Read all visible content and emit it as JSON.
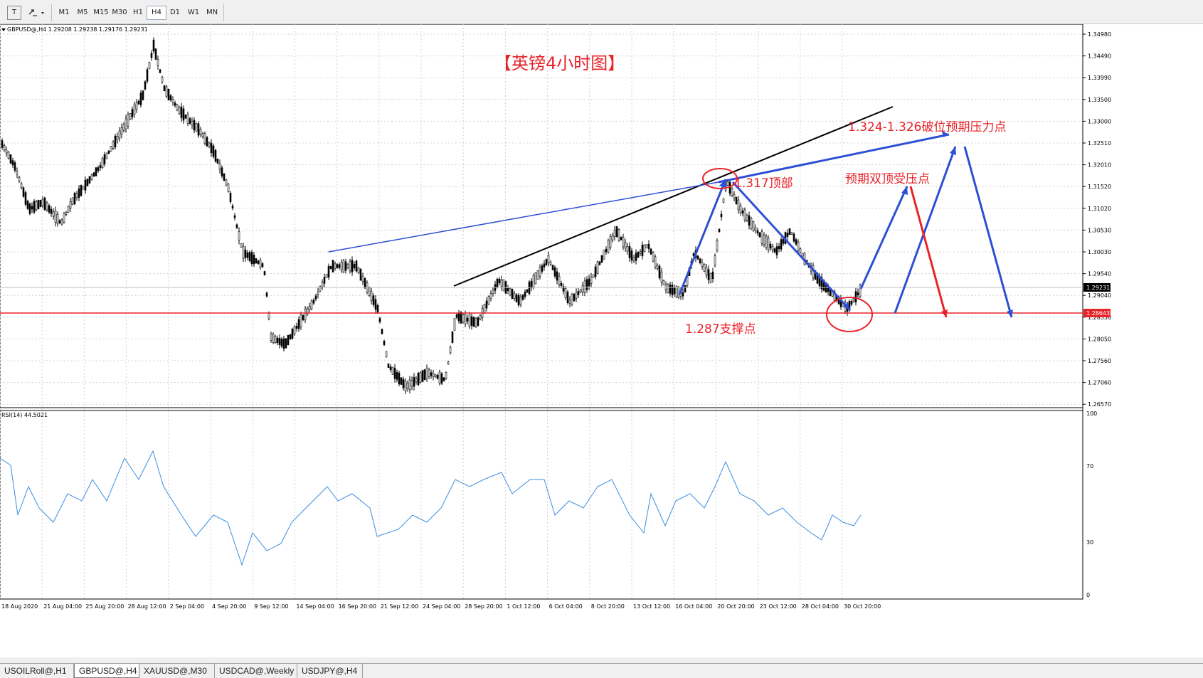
{
  "toolbar": {
    "text_tool_label": "T",
    "timeframes": [
      "M1",
      "M5",
      "M15",
      "M30",
      "H1",
      "H4",
      "D1",
      "W1",
      "MN"
    ],
    "active_timeframe": "H4"
  },
  "chart": {
    "header": "GBPUSD@,H4  1.29208 1.29238 1.29176 1.29231",
    "title_annotation": "【英镑4小时图】",
    "annotations": {
      "resistance": "1.324-1.326破位预期压力点",
      "top": "1.317顶部",
      "double_top": "预期双顶受压点",
      "support": "1.287支撑点"
    },
    "price_axis": [
      "1.34980",
      "1.34490",
      "1.33990",
      "1.33500",
      "1.33000",
      "1.32510",
      "1.32010",
      "1.31520",
      "1.31020",
      "1.30530",
      "1.30030",
      "1.29540",
      "1.29040",
      "1.28550",
      "1.28050",
      "1.27560",
      "1.27060",
      "1.26570"
    ],
    "current_price_label": "1.29231",
    "support_price_label": "1.28643",
    "time_axis": [
      "18 Aug 2020",
      "21 Aug 04:00",
      "25 Aug 20:00",
      "28 Aug 12:00",
      "2 Sep 04:00",
      "4 Sep 20:00",
      "9 Sep 12:00",
      "14 Sep 04:00",
      "16 Sep 20:00",
      "21 Sep 12:00",
      "24 Sep 04:00",
      "28 Sep 20:00",
      "1 Oct 12:00",
      "6 Oct 04:00",
      "8 Oct 20:00",
      "13 Oct 12:00",
      "16 Oct 04:00",
      "20 Oct 20:00",
      "23 Oct 12:00",
      "28 Oct 04:00",
      "30 Oct 20:00"
    ]
  },
  "rsi": {
    "header": "RSI(14) 44.5021",
    "axis": [
      "100",
      "70",
      "30",
      "0"
    ]
  },
  "tabs": [
    "USOILRoll@,H1",
    "GBPUSD@,H4",
    "XAUUSD@,M30",
    "USDCAD@,Weekly",
    "USDJPY@,H4"
  ],
  "active_tab": "GBPUSD@,H4",
  "colors": {
    "candle": "#000000",
    "support_line": "#e8232a",
    "trend_arrows": "#2d4fd4",
    "rsi_line": "#3b8ee0",
    "annotation_text": "#e8232a"
  }
}
